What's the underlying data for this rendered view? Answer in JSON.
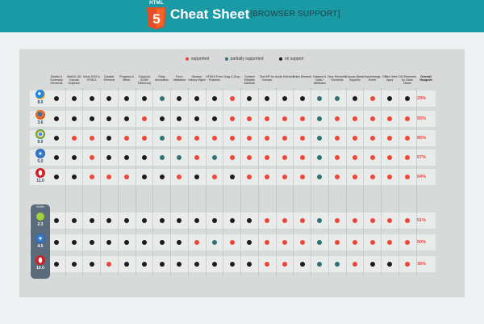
{
  "header": {
    "logo_text": "HTML",
    "logo_number": "5",
    "title": "Cheat Sheet",
    "subtitle": "[BROWSER SUPPORT]"
  },
  "legend": [
    {
      "key": "supported",
      "label": "supported",
      "color": "#f0453a"
    },
    {
      "key": "partial",
      "label": "partially supported",
      "color": "#2e7276"
    },
    {
      "key": "none",
      "label": "no support",
      "color": "#1c1c1c"
    }
  ],
  "mobile_label": "Mobile",
  "chart_data": {
    "type": "table",
    "columns": [
      "Details & Summary Elements",
      "WebGL-3D Canvas Graphics",
      "Inline SVG in HTML5",
      "Datalist Element",
      "Progress & Meter",
      "ClassList (DOM TokenList)",
      "Ruby Annotation",
      "Form Validation",
      "Session History Mgmt",
      "HTML5 Form Features",
      "Drag & Drop",
      "Content Editable Attribute",
      "Text API for Canvas",
      "Audio Element",
      "Video Element",
      "Dataset & Data-* Attributes",
      "New Semantic Elements",
      "Canvas (Basic Support)",
      "Hashchange Event",
      "Offline Web Apps",
      "Get Elements by Class Name"
    ],
    "overall_header": "Overall Support",
    "rows": [
      {
        "browser": "IE",
        "icon": "internet-explorer-icon",
        "version": "8.0",
        "mobile": false,
        "overall": "29%",
        "values": [
          "N",
          "N",
          "N",
          "N",
          "N",
          "N",
          "P",
          "N",
          "N",
          "N",
          "S",
          "N",
          "N",
          "N",
          "N",
          "P",
          "P",
          "N",
          "S",
          "N",
          "N"
        ]
      },
      {
        "browser": "Firefox",
        "icon": "firefox-icon",
        "version": "3.6",
        "mobile": false,
        "overall": "55%",
        "values": [
          "N",
          "N",
          "N",
          "N",
          "N",
          "S",
          "N",
          "N",
          "N",
          "N",
          "S",
          "S",
          "S",
          "S",
          "S",
          "P",
          "S",
          "S",
          "S",
          "S",
          "S"
        ]
      },
      {
        "browser": "Chrome",
        "icon": "chrome-icon",
        "version": "9.0",
        "mobile": false,
        "overall": "85%",
        "values": [
          "N",
          "S",
          "S",
          "N",
          "S",
          "S",
          "P",
          "S",
          "S",
          "S",
          "S",
          "S",
          "S",
          "S",
          "S",
          "P",
          "S",
          "S",
          "S",
          "S",
          "S"
        ]
      },
      {
        "browser": "Safari",
        "icon": "safari-icon",
        "version": "5.0",
        "mobile": false,
        "overall": "67%",
        "values": [
          "N",
          "N",
          "S",
          "N",
          "N",
          "N",
          "P",
          "P",
          "S",
          "P",
          "S",
          "S",
          "S",
          "S",
          "S",
          "P",
          "S",
          "S",
          "S",
          "S",
          "S"
        ]
      },
      {
        "browser": "Opera",
        "icon": "opera-icon",
        "version": "11.0",
        "mobile": false,
        "overall": "64%",
        "values": [
          "N",
          "N",
          "S",
          "S",
          "S",
          "N",
          "N",
          "S",
          "N",
          "S",
          "N",
          "S",
          "S",
          "S",
          "S",
          "P",
          "S",
          "S",
          "S",
          "S",
          "S"
        ]
      },
      {
        "browser": "Android",
        "icon": "android-icon",
        "version": "2.3",
        "mobile": true,
        "overall": "51%",
        "values": [
          "N",
          "N",
          "N",
          "N",
          "N",
          "N",
          "N",
          "N",
          "N",
          "N",
          "N",
          "N",
          "S",
          "S",
          "S",
          "P",
          "S",
          "S",
          "S",
          "S",
          "S"
        ]
      },
      {
        "browser": "iOS Safari",
        "icon": "ios-safari-icon",
        "version": "4.5",
        "mobile": true,
        "overall": "50%",
        "values": [
          "N",
          "N",
          "N",
          "N",
          "N",
          "N",
          "N",
          "N",
          "S",
          "P",
          "S",
          "N",
          "S",
          "S",
          "S",
          "P",
          "S",
          "S",
          "S",
          "S",
          "S"
        ]
      },
      {
        "browser": "Opera Mobile",
        "icon": "opera-mobile-icon",
        "version": "10.0",
        "mobile": true,
        "overall": "36%",
        "values": [
          "N",
          "N",
          "N",
          "S",
          "N",
          "N",
          "N",
          "N",
          "N",
          "N",
          "N",
          "N",
          "S",
          "S",
          "N",
          "P",
          "P",
          "S",
          "N",
          "N",
          "S"
        ]
      }
    ]
  },
  "colors": {
    "supported": "#f0453a",
    "partial": "#2e7276",
    "none": "#1c1c1c",
    "header_bg": "#1a9aa4"
  }
}
